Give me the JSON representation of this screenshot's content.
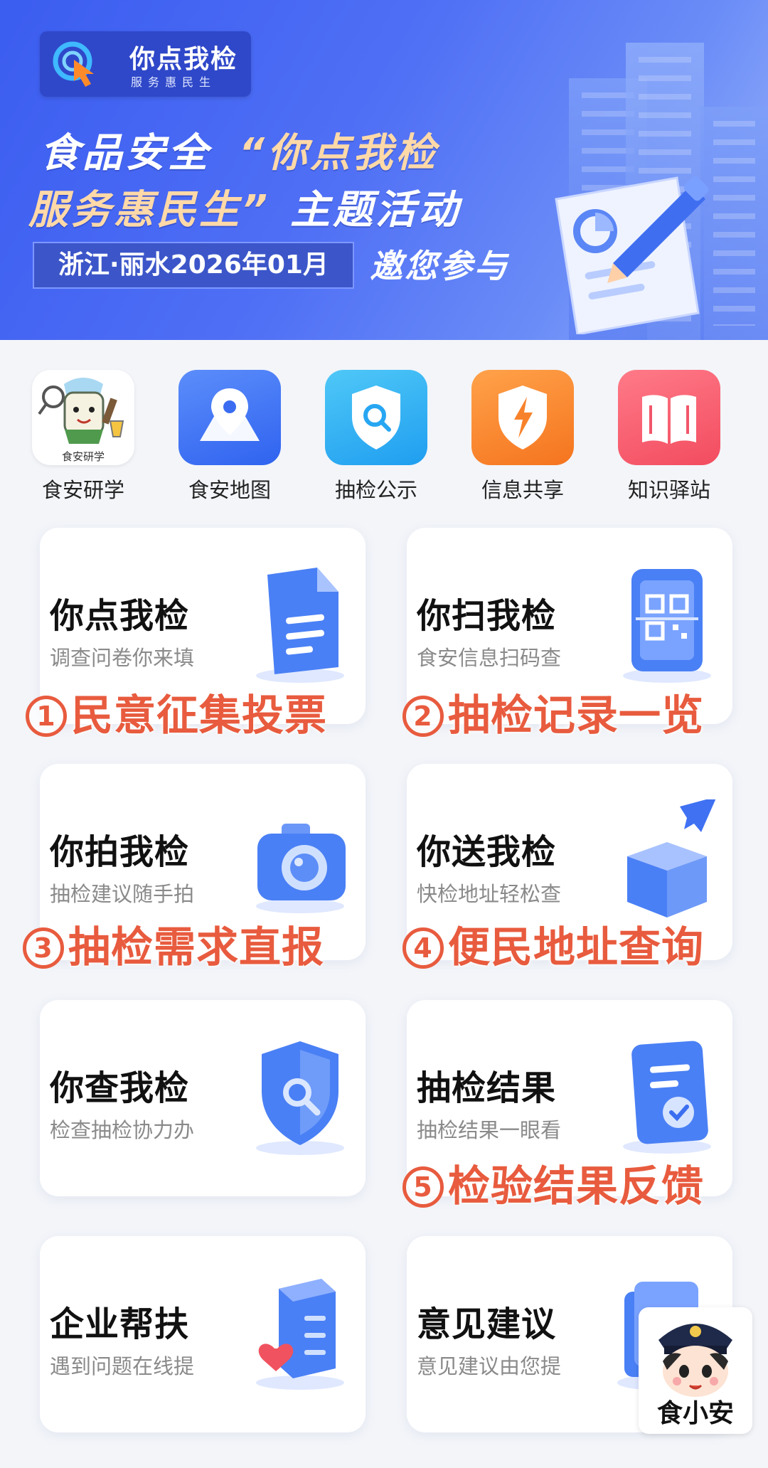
{
  "banner": {
    "logo_title": "你点我检",
    "logo_sub": "服务惠民生",
    "headline_line1_a": "食品安全",
    "headline_line1_b": "“你点我检",
    "headline_line2_a": "服务惠民生”",
    "headline_line2_b": "主题活动",
    "location_date": "浙江·丽水2026年01月",
    "invite": "邀您参与"
  },
  "shortcuts": [
    {
      "label": "食安研学",
      "icon": "mascot-icon",
      "badge": "食安研学"
    },
    {
      "label": "食安地图",
      "icon": "map-pin-icon"
    },
    {
      "label": "抽检公示",
      "icon": "shield-search-icon"
    },
    {
      "label": "信息共享",
      "icon": "shield-bolt-icon"
    },
    {
      "label": "知识驿站",
      "icon": "book-icon"
    }
  ],
  "cards": [
    {
      "title": "你点我检",
      "subtitle": "调查问卷你来填",
      "icon": "document-icon"
    },
    {
      "title": "你扫我检",
      "subtitle": "食安信息扫码查",
      "icon": "qr-code-icon"
    },
    {
      "title": "你拍我检",
      "subtitle": "抽检建议随手拍",
      "icon": "camera-icon"
    },
    {
      "title": "你送我检",
      "subtitle": "快检地址轻松查",
      "icon": "box-send-icon"
    },
    {
      "title": "你查我检",
      "subtitle": "检查抽检协力办",
      "icon": "shield-search-icon"
    },
    {
      "title": "抽检结果",
      "subtitle": "抽检结果一眼看",
      "icon": "report-check-icon"
    },
    {
      "title": "企业帮扶",
      "subtitle": "遇到问题在线提",
      "icon": "server-heart-icon"
    },
    {
      "title": "意见建议",
      "subtitle": "意见建议由您提",
      "icon": "feedback-icon"
    }
  ],
  "annotations": [
    {
      "num": "1",
      "text": "民意征集投票"
    },
    {
      "num": "2",
      "text": "抽检记录一览"
    },
    {
      "num": "3",
      "text": "抽检需求直报"
    },
    {
      "num": "4",
      "text": "便民地址查询"
    },
    {
      "num": "5",
      "text": "检验结果反馈"
    }
  ],
  "mascot": {
    "name": "食小安"
  },
  "colors": {
    "primary": "#3b5df0",
    "annotation": "#e85b3e",
    "card_bg": "#ffffff",
    "page_bg": "#f3f5f9"
  }
}
